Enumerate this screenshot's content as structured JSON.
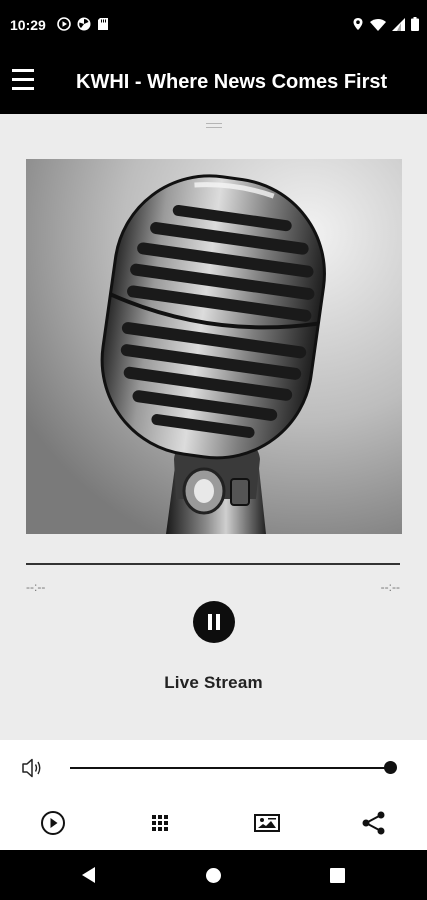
{
  "status_bar": {
    "time": "10:29",
    "left_icons": [
      "play-circle-icon",
      "fan-icon",
      "sd-card-icon"
    ],
    "right_icons": [
      "location-icon",
      "wifi-icon",
      "signal-icon",
      "battery-icon"
    ]
  },
  "app_bar": {
    "menu_icon": "hamburger-menu-icon",
    "title": "KWHI - Where News Comes First"
  },
  "player": {
    "artwork_icon": "microphone-artwork",
    "progress": 0,
    "elapsed": "--:--",
    "duration": "--:--",
    "state": "playing",
    "control_icon": "pause-icon",
    "track_title": "Live Stream"
  },
  "volume": {
    "icon": "speaker-volume-icon",
    "level": 1.0
  },
  "toolbar": {
    "items": [
      "play-circle-icon",
      "grid-icon",
      "image-gallery-icon",
      "share-icon"
    ]
  },
  "nav_bar": {
    "items": [
      "back-icon",
      "home-icon",
      "recents-icon"
    ]
  },
  "colors": {
    "app_bar_bg": "#000000",
    "content_bg": "#ececec",
    "accent": "#111111"
  }
}
